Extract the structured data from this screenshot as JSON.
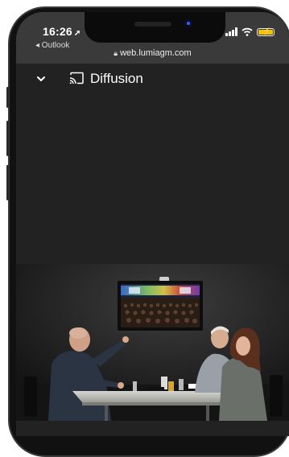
{
  "status_bar": {
    "time": "16:26",
    "back_app": "◂ Outlook",
    "url": "web.lumiagm.com"
  },
  "header": {
    "title": "Diffusion",
    "collapse_icon": "chevron-down-icon",
    "cast_icon": "cast-icon"
  },
  "colors": {
    "app_bg": "#222222",
    "status_bg": "#3a3a3a",
    "battery": "#f2c500"
  }
}
